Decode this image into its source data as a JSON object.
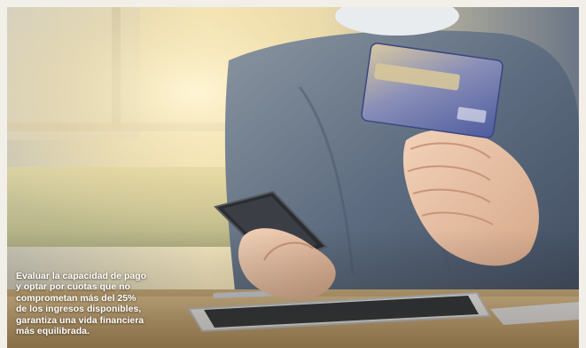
{
  "caption": {
    "lines": [
      "Evaluar la capacidad de pago",
      "y optar por cuotas que no",
      "comprometan más del 25%",
      "de los ingresos disponibles,",
      "garantiza una vida financiera",
      "más equilibrada."
    ]
  },
  "colors": {
    "frame": "#f2efe9",
    "caption_text": "#ffffff",
    "card_body": "#5b66a8",
    "card_stripe": "#d7c79a",
    "shirt": "#5d6c80",
    "table": "#c9a979"
  }
}
